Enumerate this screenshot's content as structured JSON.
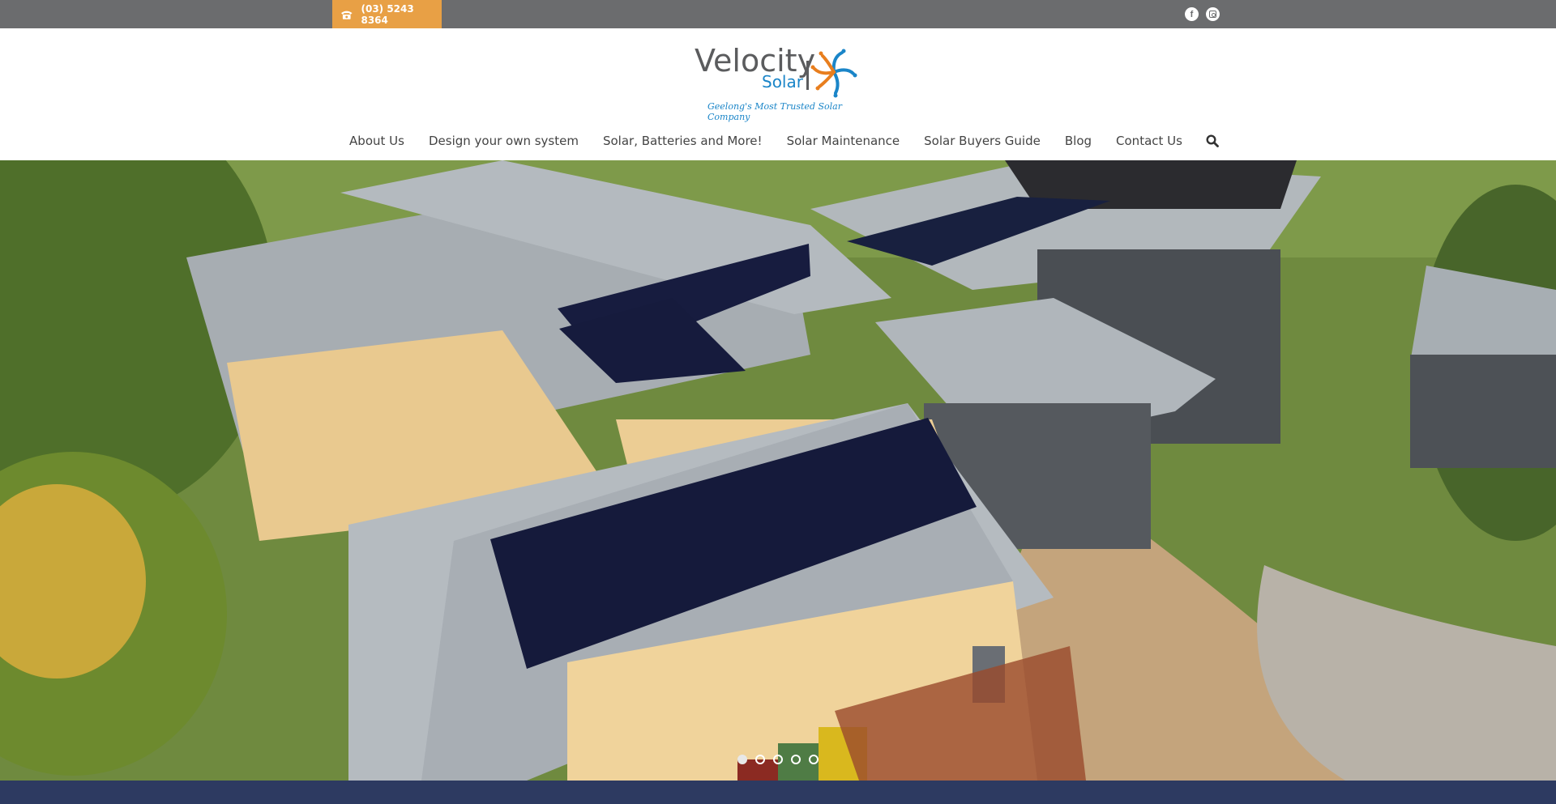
{
  "topbar": {
    "phone_icon": "phone-icon",
    "phone": "(03) 5243 8364",
    "social": [
      {
        "name": "facebook",
        "icon": "facebook-icon",
        "glyph": "f"
      },
      {
        "name": "instagram",
        "icon": "instagram-icon"
      }
    ]
  },
  "logo": {
    "word": "Velocity",
    "sub": "Solar",
    "tagline": "Geelong's Most Trusted Solar Company",
    "colors": {
      "grey": "#5b5c5e",
      "blue": "#1a85c8",
      "orange": "#e87e1e"
    }
  },
  "nav": {
    "items": [
      {
        "label": "About Us"
      },
      {
        "label": "Design your own system"
      },
      {
        "label": "Solar, Batteries and More!"
      },
      {
        "label": "Solar Maintenance"
      },
      {
        "label": "Solar Buyers Guide"
      },
      {
        "label": "Blog"
      },
      {
        "label": "Contact Us"
      }
    ],
    "search_icon": "search-icon"
  },
  "hero": {
    "image": "Aerial photo of a house with solar panels on corrugated roofs",
    "slides": 5,
    "active_slide": 1
  },
  "colors": {
    "topbar": "#6b6c6e",
    "phone_bg": "#e8a045",
    "footer_band": "#2d3a61"
  }
}
